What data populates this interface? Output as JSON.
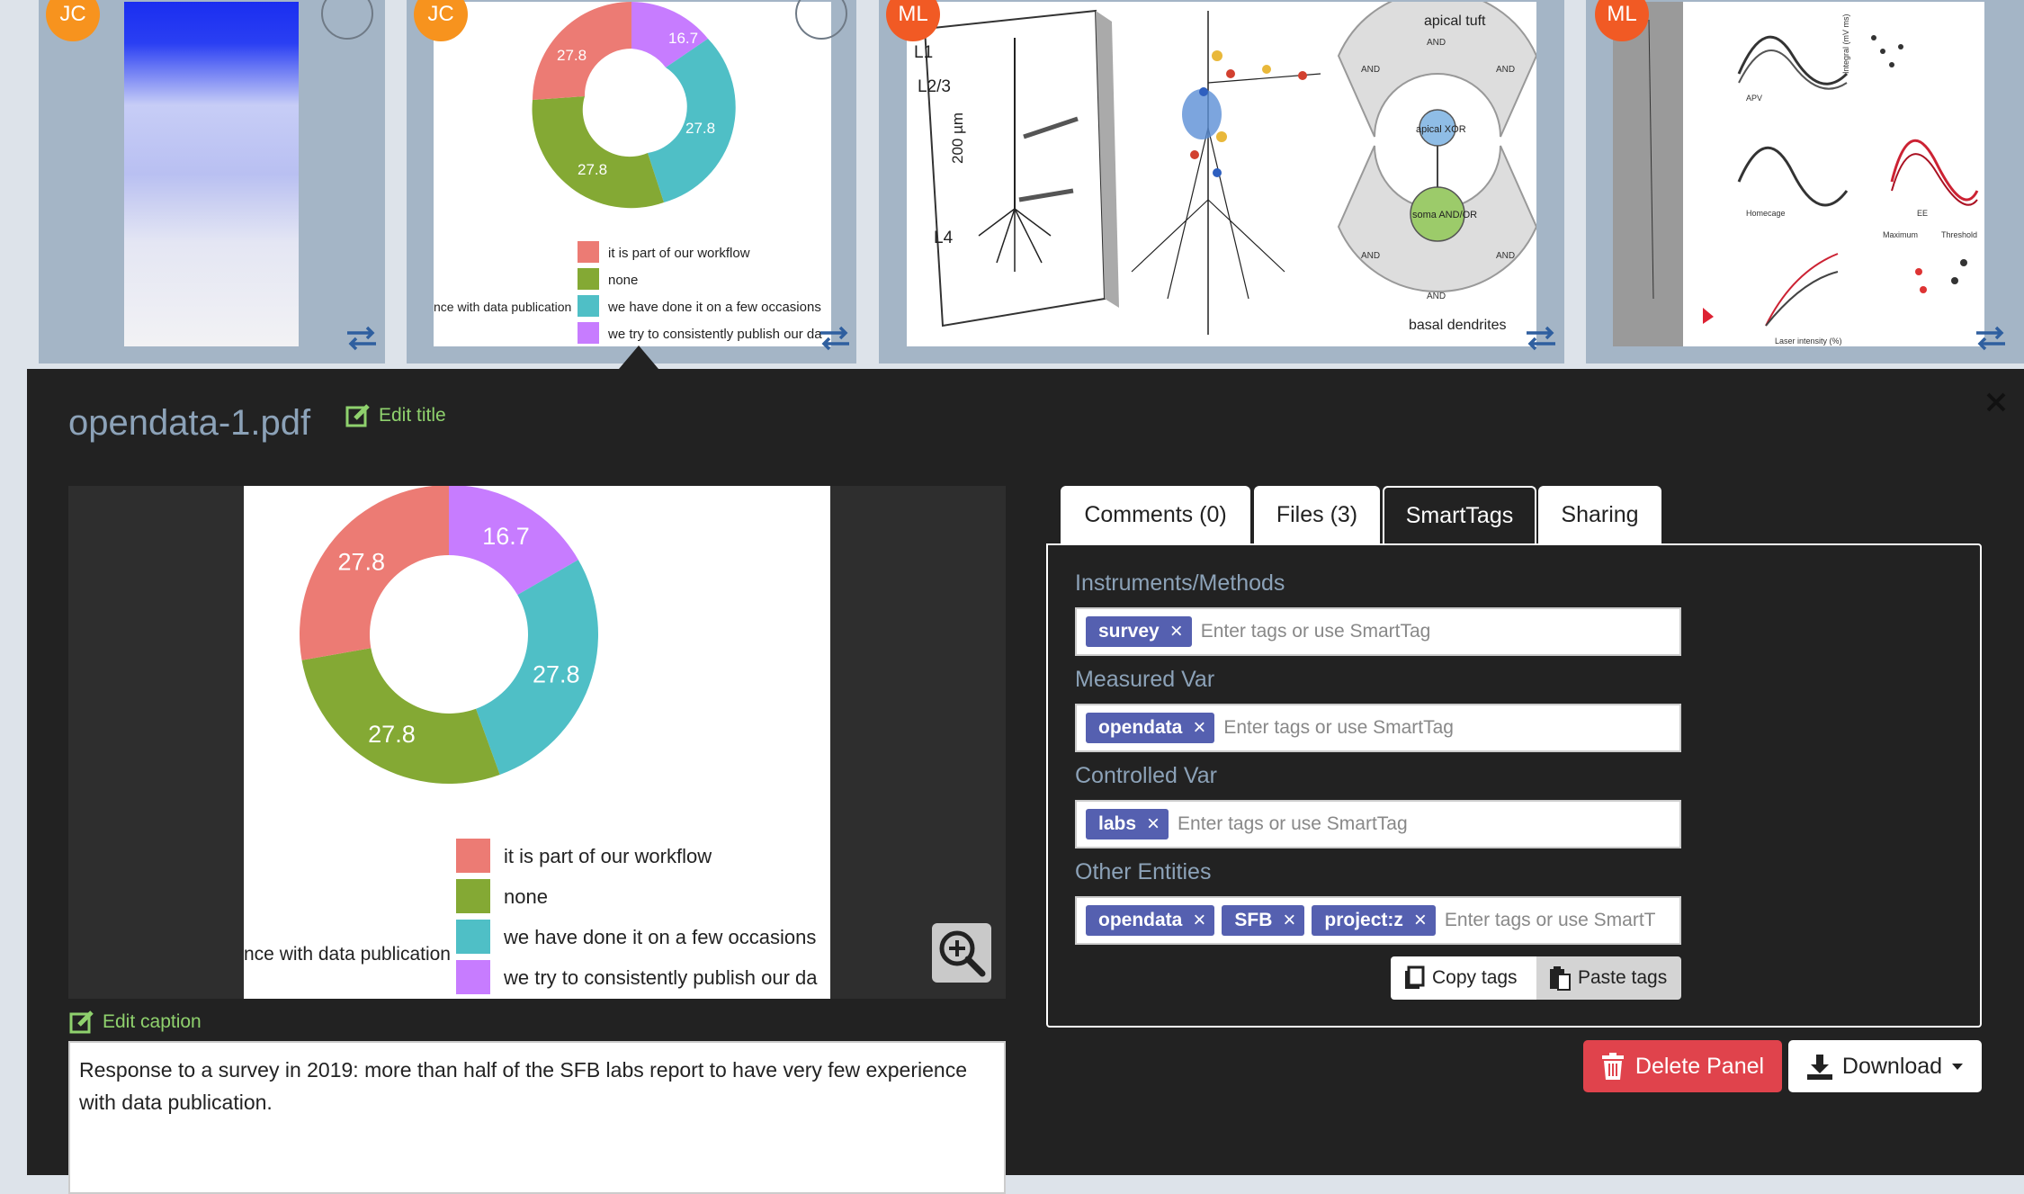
{
  "thumbnails": [
    {
      "avatar": "JC",
      "avatar_color": "#f7931e"
    },
    {
      "avatar": "JC",
      "avatar_color": "#f7931e"
    },
    {
      "avatar": "ML",
      "avatar_color": "#f15a24"
    },
    {
      "avatar": "ML",
      "avatar_color": "#f15a24"
    }
  ],
  "thumb_neuron": {
    "left_labels": [
      "L1",
      "L2/3",
      "L4"
    ],
    "scale_label": "200 µm",
    "right_labels": [
      "apical tuft",
      "apical XOR",
      "soma AND/OR",
      "basal dendrites"
    ],
    "gate_labels": [
      "AND",
      "AND",
      "AND",
      "AND",
      "AND",
      "AND"
    ]
  },
  "thumb_traces": {
    "panel_labels": [
      "APV",
      "Homecage",
      "EE",
      "Maximum",
      "Threshold",
      "Laser intensity (%)",
      "Integral (mV ms)"
    ]
  },
  "panel": {
    "title": "opendata-1.pdf",
    "edit_title": "Edit title",
    "edit_caption": "Edit caption",
    "caption": "Response to a survey in 2019: more than half of the SFB labs report to have very few experience with data publication."
  },
  "chart_data": {
    "type": "pie",
    "donut": true,
    "labels": [
      "we try to consistently publish our data",
      "we have done it on a few occasions",
      "none",
      "it is part of our workflow"
    ],
    "values": [
      16.7,
      27.8,
      27.8,
      27.8
    ],
    "value_labels": [
      "16.7",
      "27.8",
      "27.8",
      "27.8"
    ],
    "colors": [
      "#c77cff",
      "#4fbfc6",
      "#84a934",
      "#ec7b74"
    ],
    "legend_labels": [
      "it is part of our workflow",
      "none",
      "we have done it on a few occasions",
      "we try to consistently publish our da"
    ],
    "legend_colors": [
      "#ec7b74",
      "#84a934",
      "#4fbfc6",
      "#c77cff"
    ],
    "side_label": "nce with data publication"
  },
  "tabs": [
    {
      "label": "Comments (0)",
      "active": false
    },
    {
      "label": "Files (3)",
      "active": false
    },
    {
      "label": "SmartTags",
      "active": true
    },
    {
      "label": "Sharing",
      "active": false
    }
  ],
  "smarttags": {
    "placeholder": "Enter tags or use SmartTag",
    "placeholder_truncated": "Enter tags or use SmartT",
    "sections": [
      {
        "label": "Instruments/Methods",
        "tags": [
          "survey"
        ]
      },
      {
        "label": "Measured Var",
        "tags": [
          "opendata"
        ]
      },
      {
        "label": "Controlled Var",
        "tags": [
          "labs"
        ]
      },
      {
        "label": "Other Entities",
        "tags": [
          "opendata",
          "SFB",
          "project:z"
        ]
      }
    ],
    "remove_glyph": "×",
    "copy_label": "Copy tags",
    "paste_label": "Paste tags"
  },
  "actions": {
    "delete_label": "Delete Panel",
    "download_label": "Download"
  },
  "colors": {
    "panel_bg": "#222222",
    "title": "#8ca2b8",
    "edit_link": "#8fd16d",
    "tag": "#5560b0",
    "delete": "#e0434c",
    "strip_bg": "#a4b5c6"
  }
}
